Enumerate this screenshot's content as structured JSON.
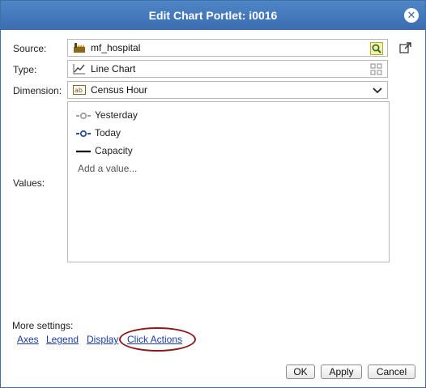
{
  "dialog": {
    "title": "Edit Chart Portlet: i0016",
    "close_icon": "close-icon"
  },
  "form": {
    "source_label": "Source:",
    "source_value": "mf_hospital",
    "type_label": "Type:",
    "type_value": "Line Chart",
    "dimension_label": "Dimension:",
    "dimension_value": "Census Hour",
    "values_label": "Values:"
  },
  "values": {
    "items": [
      {
        "label": "Yesterday",
        "color": "#a0a0a0",
        "style": "dashed-circle"
      },
      {
        "label": "Today",
        "color": "#2c4f94",
        "style": "dashed-circle"
      },
      {
        "label": "Capacity",
        "color": "#000000",
        "style": "solid"
      }
    ],
    "add_placeholder": "Add a value..."
  },
  "more_settings": {
    "label": "More settings:",
    "links": [
      "Axes",
      "Legend",
      "Display",
      "Click Actions"
    ]
  },
  "buttons": {
    "ok": "OK",
    "apply": "Apply",
    "cancel": "Cancel"
  },
  "colors": {
    "titlebar": "#3a6db0",
    "link": "#1a3da8",
    "highlight": "#8b1a1a"
  }
}
